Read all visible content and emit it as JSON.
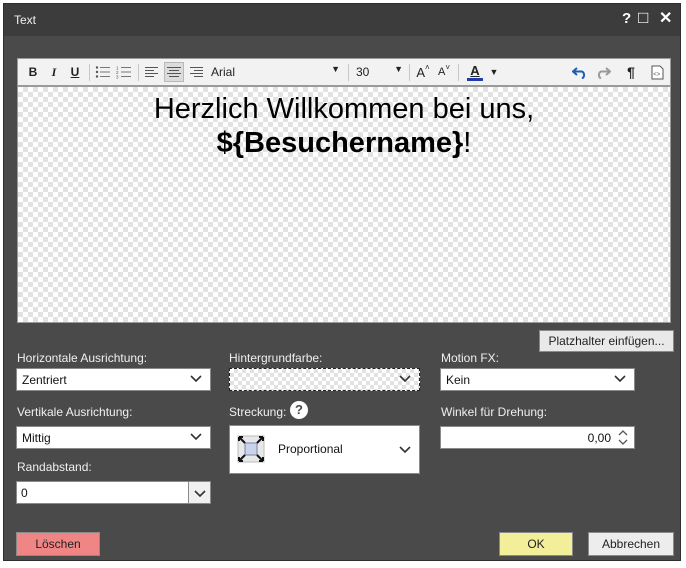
{
  "dialog": {
    "title": "Text",
    "help_glyph": "?",
    "maximize_glyph": "□",
    "close_glyph": "✕"
  },
  "toolbar": {
    "bold": "B",
    "italic": "I",
    "underline": "U",
    "font_family": "Arial",
    "font_size": "30",
    "grow_font": "A",
    "shrink_font": "A",
    "font_color": "A",
    "paragraph_mark": "¶"
  },
  "canvas": {
    "line1": "Herzlich Willkommen bei uns,",
    "line2_placeholder": "${Besuchername}",
    "line2_suffix": "!"
  },
  "insert_placeholder_label": "Platzhalter einfügen...",
  "form": {
    "horizontal": {
      "label": "Horizontale Ausrichtung:",
      "value": "Zentriert"
    },
    "vertical": {
      "label": "Vertikale Ausrichtung:",
      "value": "Mittig"
    },
    "margin": {
      "label": "Randabstand:",
      "value": "0"
    },
    "background": {
      "label": "Hintergrundfarbe:"
    },
    "stretch": {
      "label": "Streckung:",
      "value": "Proportional"
    },
    "motion": {
      "label": "Motion FX:",
      "value": "Kein"
    },
    "rotation": {
      "label": "Winkel für Drehung:",
      "value": "0,00"
    }
  },
  "buttons": {
    "delete": "Löschen",
    "ok": "OK",
    "cancel": "Abbrechen"
  },
  "colors": {
    "dialog_bg": "#4a4a4a",
    "titlebar_bg": "#3c3c3c",
    "delete_bg": "#f08585",
    "ok_bg": "#f3ee9a",
    "font_color_swatch": "#1f3fa8",
    "undo_icon": "#1a5fb4"
  }
}
